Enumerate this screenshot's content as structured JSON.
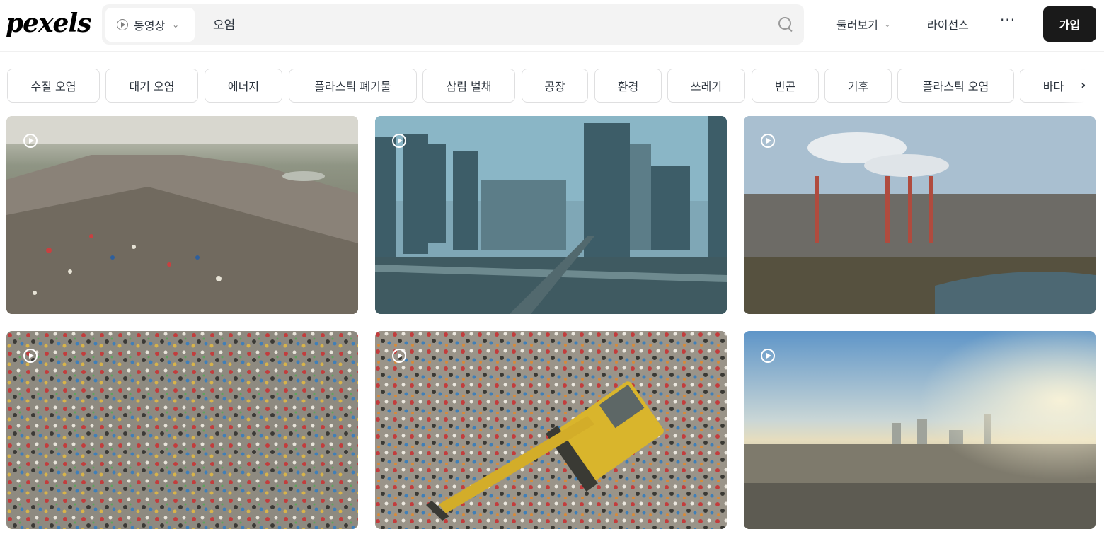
{
  "brand": {
    "logo_text": "pexels"
  },
  "search": {
    "media_type": "동영상",
    "query": "오염"
  },
  "nav": {
    "explore": "둘러보기",
    "license": "라이선스",
    "more": "···",
    "join": "가입"
  },
  "tags": [
    "수질 오염",
    "대기 오염",
    "에너지",
    "플라스틱 폐기물",
    "삼림 벌채",
    "공장",
    "환경",
    "쓰레기",
    "빈곤",
    "기후",
    "플라스틱 오염",
    "바다"
  ],
  "videos": [
    {
      "subject": "landfill-hill",
      "icon": "play-circle-icon"
    },
    {
      "subject": "city-highway-smog",
      "icon": "play-circle-icon"
    },
    {
      "subject": "factory-smokestacks",
      "icon": "play-circle-icon"
    },
    {
      "subject": "garbage-aerial",
      "icon": "play-circle-icon"
    },
    {
      "subject": "excavator-garbage",
      "icon": "play-circle-icon"
    },
    {
      "subject": "hazy-city-skyline",
      "icon": "play-circle-icon"
    }
  ]
}
